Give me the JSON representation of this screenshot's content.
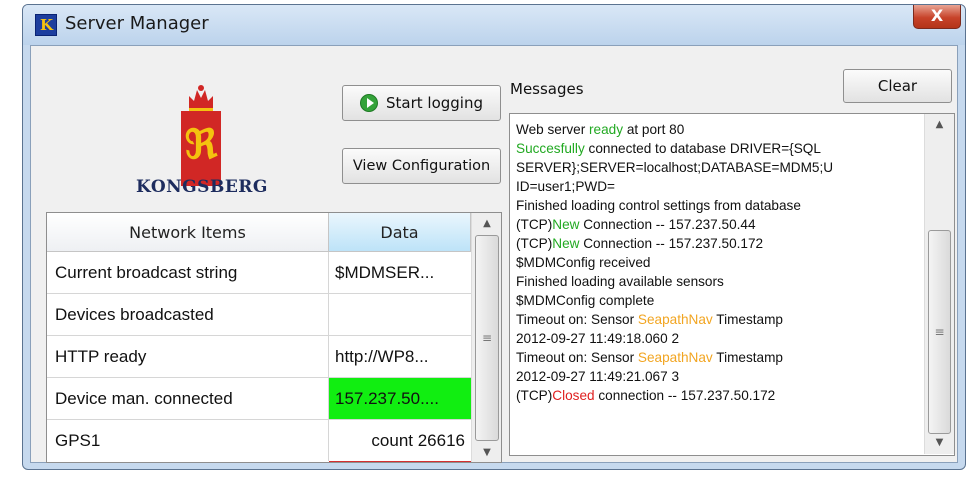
{
  "window": {
    "title": "Server Manager",
    "close_label": "X"
  },
  "logo": {
    "text": "KONGSBERG"
  },
  "buttons": {
    "start_logging": "Start logging",
    "view_configuration": "View Configuration",
    "clear": "Clear"
  },
  "table": {
    "headers": [
      "Network Items",
      "Data"
    ],
    "rows": [
      {
        "name": "Current broadcast string",
        "data": "$MDMSER..."
      },
      {
        "name": "Devices broadcasted",
        "data": ""
      },
      {
        "name": "HTTP ready",
        "data": "http://WP8..."
      },
      {
        "name": "Device man. connected",
        "data": "157.237.50...."
      },
      {
        "name": "GPS1",
        "data": "count 26616"
      }
    ]
  },
  "messages": {
    "label": "Messages",
    "lines": [
      [
        "Web server ",
        "ready",
        " at port 80"
      ],
      [
        "Succesfully",
        " connected to database DRIVER={SQL"
      ],
      [
        "SERVER};SERVER=localhost;DATABASE=MDM5;U"
      ],
      [
        "ID=user1;PWD="
      ],
      [
        "Finished loading control settings from database"
      ],
      [
        "(TCP)",
        "New",
        " Connection -- 157.237.50.44"
      ],
      [
        "(TCP)",
        "New",
        " Connection -- 157.237.50.172"
      ],
      [
        "$MDMConfig received"
      ],
      [
        "Finished loading available sensors"
      ],
      [
        "$MDMConfig complete"
      ],
      [
        "Timeout on: Sensor ",
        "SeapathNav",
        " Timestamp"
      ],
      [
        "2012-09-27 11:49:18.060 2"
      ],
      [
        "Timeout on: Sensor ",
        "SeapathNav",
        " Timestamp"
      ],
      [
        "2012-09-27 11:49:21.067 3"
      ],
      [
        "(TCP)",
        "Closed",
        " connection -- 157.237.50.172"
      ]
    ]
  },
  "colors": {
    "ready": "#22a922",
    "warning": "#f2a521",
    "closed": "#e02020",
    "connected_cell": "#11ee11"
  }
}
